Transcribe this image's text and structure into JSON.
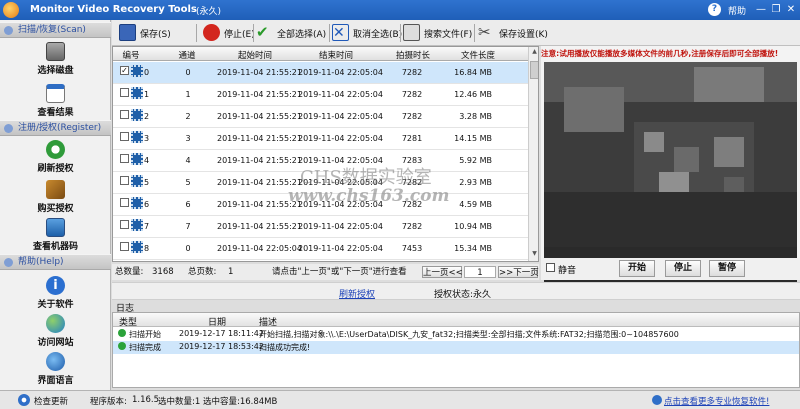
{
  "window": {
    "title": "Monitor Video Recovery Tools",
    "edition": "(永久)",
    "help": "帮助",
    "min": "—",
    "restore": "❐",
    "close": "✕"
  },
  "sidebar": {
    "section1": "扫描/恢复(Scan)",
    "section2": "注册/授权(Register)",
    "section3": "帮助(Help)",
    "items": [
      "选择磁盘",
      "查看结果",
      "刷新授权",
      "购买授权",
      "查看机器码",
      "关于软件",
      "访问网站",
      "界面语言"
    ]
  },
  "toolbar": {
    "save": "保存(S)",
    "stop": "停止(E)",
    "select_all": "全部选择(A)",
    "deselect_all": "取消全选(B)",
    "search_file": "搜索文件(F)",
    "save_settings": "保存设置(K)"
  },
  "grid": {
    "headers": [
      "编号",
      "通道",
      "起始时间",
      "结束时间",
      "拍摄时长",
      "文件长度"
    ],
    "rows": [
      {
        "num": "0",
        "ch": "0",
        "start": "2019-11-04 21:55:21",
        "end": "2019-11-04 22:05:04",
        "dur": "7282",
        "size": "16.84 MB",
        "checked": "✓"
      },
      {
        "num": "1",
        "ch": "1",
        "start": "2019-11-04 21:55:21",
        "end": "2019-11-04 22:05:04",
        "dur": "7282",
        "size": "12.46 MB",
        "checked": ""
      },
      {
        "num": "2",
        "ch": "2",
        "start": "2019-11-04 21:55:21",
        "end": "2019-11-04 22:05:04",
        "dur": "7282",
        "size": "3.28 MB",
        "checked": ""
      },
      {
        "num": "3",
        "ch": "3",
        "start": "2019-11-04 21:55:21",
        "end": "2019-11-04 22:05:04",
        "dur": "7281",
        "size": "14.15 MB",
        "checked": ""
      },
      {
        "num": "4",
        "ch": "4",
        "start": "2019-11-04 21:55:21",
        "end": "2019-11-04 22:05:04",
        "dur": "7283",
        "size": "5.92 MB",
        "checked": ""
      },
      {
        "num": "5",
        "ch": "5",
        "start": "2019-11-04 21:55:21",
        "end": "2019-11-04 22:05:04",
        "dur": "7282",
        "size": "2.93 MB",
        "checked": ""
      },
      {
        "num": "6",
        "ch": "6",
        "start": "2019-11-04 21:55:21",
        "end": "2019-11-04 22:05:04",
        "dur": "7282",
        "size": "4.59 MB",
        "checked": ""
      },
      {
        "num": "7",
        "ch": "7",
        "start": "2019-11-04 21:55:21",
        "end": "2019-11-04 22:05:04",
        "dur": "7282",
        "size": "10.94 MB",
        "checked": ""
      },
      {
        "num": "8",
        "ch": "0",
        "start": "2019-11-04 22:05:04",
        "end": "2019-11-04 22:05:04",
        "dur": "7453",
        "size": "15.34 MB",
        "checked": ""
      }
    ]
  },
  "pager": {
    "total_label": "总数量:",
    "total": "3168",
    "pages_label": "总页数:",
    "pages": "1",
    "hint": "请点击\"上一页\"或\"下一页\"进行查看",
    "prev": "上一页<<",
    "current": "1",
    "next": ">>下一页"
  },
  "preview": {
    "notice": "注意:试用播放仅能播放多媒体文件的前几秒,注册保存后即可全部播放!",
    "mute": "静音",
    "play": "开始",
    "stop": "停止",
    "pause": "暂停"
  },
  "strip": {
    "refresh": "刷新授权",
    "auth_status": "授权状态:永久"
  },
  "log": {
    "title": "日志",
    "headers": [
      "类型",
      "日期",
      "描述"
    ],
    "rows": [
      {
        "type": "扫描开始",
        "date": "2019-12-17 18:11:42",
        "desc": "开始扫描,扫描对象:\\\\.\\E:\\UserData\\DISK_九安_fat32;扫描类型:全部扫描;文件系统:FAT32;扫描范围:0~104857600"
      },
      {
        "type": "扫描完成",
        "date": "2019-12-17 18:53:42",
        "desc": "扫描成功完成!"
      }
    ]
  },
  "statusbar": {
    "check_update": "检查更新",
    "version_label": "程序版本:",
    "version": "1.16.5",
    "selection": "选中数量:1  选中容量:16.84MB",
    "promo": "点击查看更多专业恢复软件!"
  },
  "watermark": {
    "line1": "CHS数据实验室",
    "line2": "www.chs163.com"
  },
  "colors": {
    "titlebar": "#2f73cf",
    "accent": "#1f5fb8",
    "notice": "#c0140e",
    "selected_row": "#cfe6fb"
  }
}
